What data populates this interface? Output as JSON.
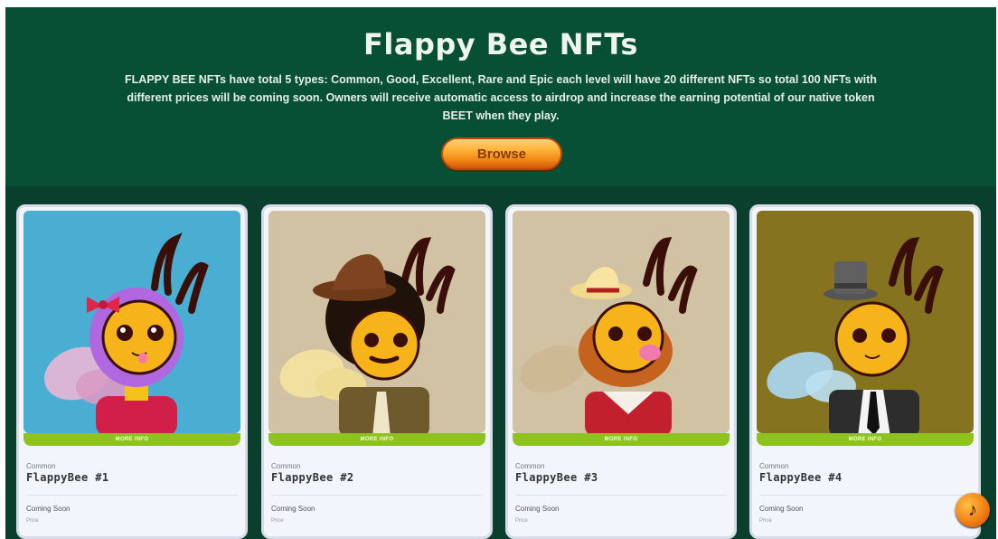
{
  "hero": {
    "title": "Flappy Bee NFTs",
    "description": "FLAPPY BEE NFTs have total 5 types: Common, Good, Excellent, Rare and Epic each level will have 20 different NFTs so total 100 NFTs with different prices will be coming soon. Owners will receive automatic access to airdrop and increase the earning potential of our native token BEET when they play.",
    "browse_label": "Browse"
  },
  "cards": [
    {
      "more_label": "MORE INFO",
      "rarity": "Common",
      "name": "FlappyBee #1",
      "status": "Coming Soon",
      "price_label": "Price",
      "bg": "#4aaed2"
    },
    {
      "more_label": "MORE INFO",
      "rarity": "Common",
      "name": "FlappyBee #2",
      "status": "Coming Soon",
      "price_label": "Price",
      "bg": "#d2c2a4"
    },
    {
      "more_label": "MORE INFO",
      "rarity": "Common",
      "name": "FlappyBee #3",
      "status": "Coming Soon",
      "price_label": "Price",
      "bg": "#d2c2a4"
    },
    {
      "more_label": "MORE INFO",
      "rarity": "Common",
      "name": "FlappyBee #4",
      "status": "Coming Soon",
      "price_label": "Price",
      "bg": "#857320"
    }
  ],
  "music_icon": "music-note-icon",
  "colors": {
    "hero_bg": "#075035",
    "page_bg": "#0a3f2d",
    "accent_green": "#8dc21f",
    "button_orange": "#f08a14"
  }
}
